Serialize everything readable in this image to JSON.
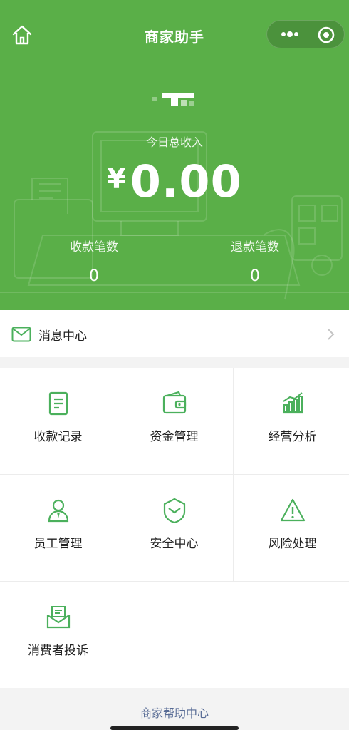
{
  "nav": {
    "title": "商家助手",
    "home_icon": "home-icon",
    "more_icon": "more-dots-icon",
    "close_icon": "target-close-icon"
  },
  "summary": {
    "today_label": "今日总收入",
    "currency": "¥",
    "amount": "0.00",
    "payments_label": "收款笔数",
    "payments_count": "0",
    "refunds_label": "退款笔数",
    "refunds_count": "0"
  },
  "message_center": {
    "label": "消息中心",
    "icon": "envelope-icon"
  },
  "menu": [
    {
      "label": "收款记录",
      "icon": "receipt-icon"
    },
    {
      "label": "资金管理",
      "icon": "wallet-icon"
    },
    {
      "label": "经营分析",
      "icon": "bar-chart-icon"
    },
    {
      "label": "员工管理",
      "icon": "staff-icon"
    },
    {
      "label": "安全中心",
      "icon": "shield-icon"
    },
    {
      "label": "风险处理",
      "icon": "warning-icon"
    },
    {
      "label": "消费者投诉",
      "icon": "complaint-mail-icon"
    }
  ],
  "footer": {
    "help_link": "商家帮助中心"
  },
  "colors": {
    "brand_green": "#5aaf48",
    "icon_green": "#4bb05c",
    "link_blue": "#576b95"
  }
}
